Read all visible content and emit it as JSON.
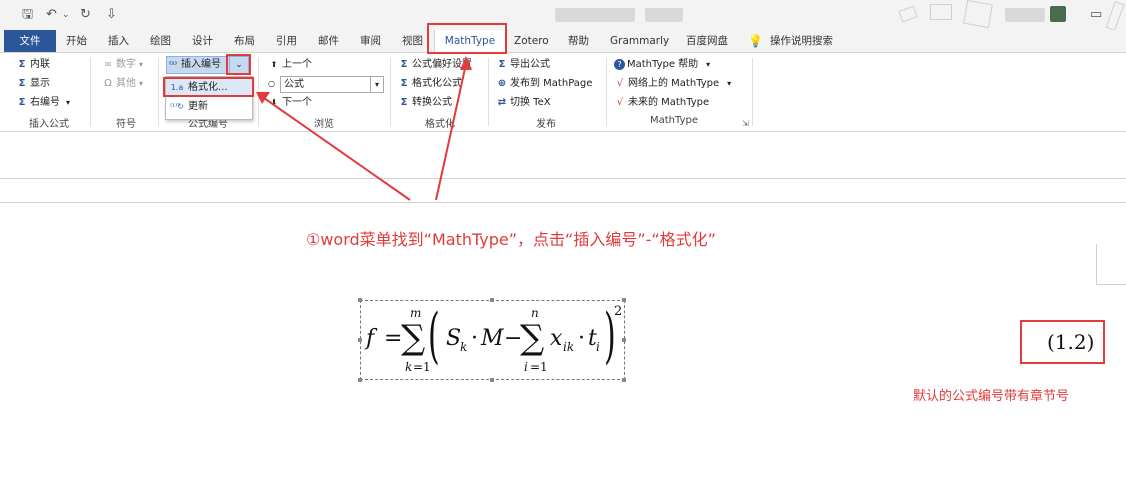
{
  "tabs": {
    "file": "文件",
    "home": "开始",
    "insert": "插入",
    "draw": "绘图",
    "design": "设计",
    "layout": "布局",
    "references": "引用",
    "mailings": "邮件",
    "review": "审阅",
    "view": "视图",
    "mathtype": "MathType",
    "zotero": "Zotero",
    "help": "帮助",
    "grammarly": "Grammarly",
    "baidu": "百度网盘",
    "tellme": "操作说明搜索"
  },
  "ribbon": {
    "insert_equation": {
      "inline": "内联",
      "display": "显示",
      "right_numbered": "右编号",
      "label": "插入公式"
    },
    "symbols": {
      "numbers": "数字",
      "others": "其他",
      "label": "符号"
    },
    "equation_numbers": {
      "insert_number": "插入编号",
      "label": "公式编号",
      "dropdown": {
        "format": "格式化...",
        "update": "更新"
      }
    },
    "browse": {
      "previous": "上一个",
      "combo_value": "公式",
      "next": "下一个",
      "label": "浏览"
    },
    "format": {
      "preferences": "公式偏好设置",
      "format_equations": "格式化公式",
      "convert": "转换公式",
      "label": "格式化"
    },
    "publish": {
      "export": "导出公式",
      "mathpage": "发布到 MathPage",
      "toggle_tex": "切换 TeX",
      "label": "发布"
    },
    "mathtype_group": {
      "help": "MathType 帮助",
      "online": "网络上的 MathType",
      "future": "未来的 MathType",
      "label": "MathType"
    }
  },
  "annotations": {
    "step1": "①word菜单找到“MathType”，点击“插入编号”-“格式化”",
    "default_note": "默认的公式编号带有章节号"
  },
  "equation": {
    "number": "(1.2)"
  },
  "colors": {
    "accent": "#2b579a",
    "annotation": "#e23b3b"
  }
}
